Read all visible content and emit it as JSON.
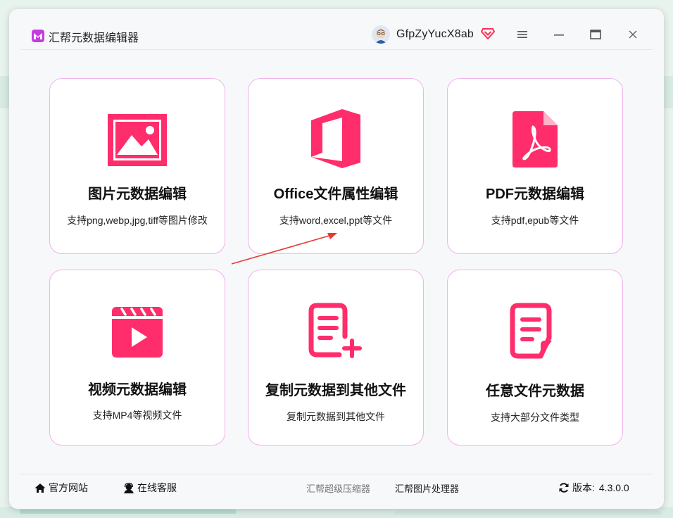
{
  "app": {
    "title": "汇帮元数据编辑器"
  },
  "user": {
    "name": "GfpZyYucX8ab"
  },
  "cards": [
    {
      "title": "图片元数据编辑",
      "desc": "支持png,webp,jpg,tiff等图片修改",
      "icon": "image-icon"
    },
    {
      "title": "Office文件属性编辑",
      "desc": "支持word,excel,ppt等文件",
      "icon": "office-icon"
    },
    {
      "title": "PDF元数据编辑",
      "desc": "支持pdf,epub等文件",
      "icon": "pdf-icon"
    },
    {
      "title": "视频元数据编辑",
      "desc": "支持MP4等视频文件",
      "icon": "video-icon"
    },
    {
      "title": "复制元数据到其他文件",
      "desc": "复制元数据到其他文件",
      "icon": "copy-doc-icon"
    },
    {
      "title": "任意文件元数据",
      "desc": "支持大部分文件类型",
      "icon": "file-icon"
    }
  ],
  "footer": {
    "website": "官方网站",
    "support": "在线客服",
    "link1": "汇帮超级压缩器",
    "link2": "汇帮图片处理器",
    "version_label": "版本:",
    "version": "4.3.0.0"
  },
  "colors": {
    "accent": "#ff2d6b",
    "card_border": "#f0b3ea"
  }
}
